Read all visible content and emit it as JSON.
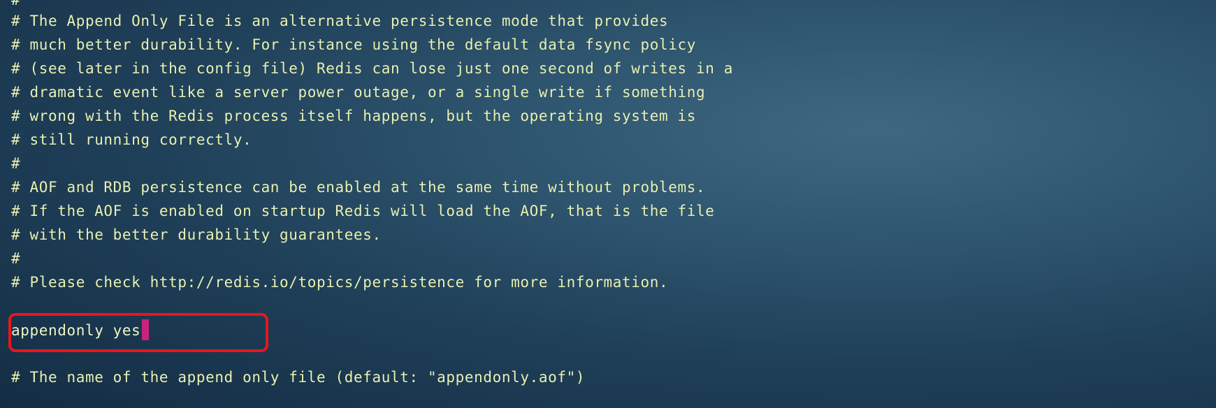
{
  "editor": {
    "lines": [
      "#",
      "# The Append Only File is an alternative persistence mode that provides",
      "# much better durability. For instance using the default data fsync policy",
      "# (see later in the config file) Redis can lose just one second of writes in a",
      "# dramatic event like a server power outage, or a single write if something",
      "# wrong with the Redis process itself happens, but the operating system is",
      "# still running correctly.",
      "#",
      "# AOF and RDB persistence can be enabled at the same time without problems.",
      "# If the AOF is enabled on startup Redis will load the AOF, that is the file",
      "# with the better durability guarantees.",
      "#",
      "# Please check http://redis.io/topics/persistence for more information.",
      "",
      "appendonly yes",
      "",
      "# The name of the append only file (default: \"appendonly.aof\")"
    ]
  },
  "colors": {
    "text": "#e9f2b4",
    "cursor": "#c8237a",
    "highlight_box": "#e8161c",
    "background": "#1f3f58"
  }
}
